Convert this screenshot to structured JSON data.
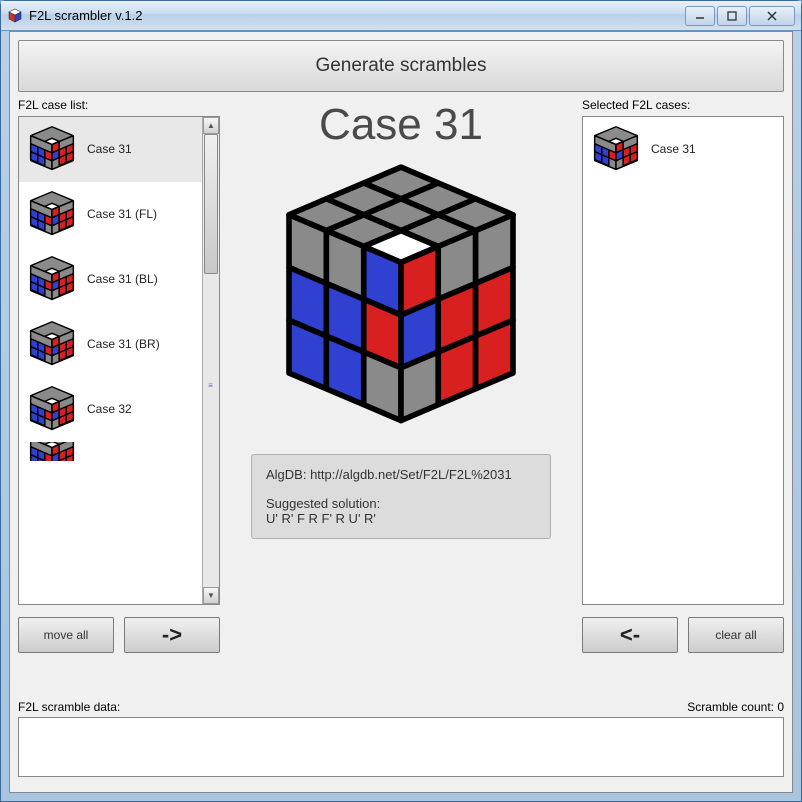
{
  "window": {
    "title": "F2L scrambler v.1.2"
  },
  "toolbar": {
    "generate_label": "Generate scrambles"
  },
  "left": {
    "header": "F2L case list:",
    "items": [
      {
        "label": "Case 31",
        "selected": true
      },
      {
        "label": "Case 31 (FL)",
        "selected": false
      },
      {
        "label": "Case 31 (BL)",
        "selected": false
      },
      {
        "label": "Case 31 (BR)",
        "selected": false
      },
      {
        "label": "Case 32",
        "selected": false
      }
    ],
    "move_all_label": "move all",
    "arrow_label": "->"
  },
  "main": {
    "case_title": "Case 31",
    "algdb_label": "AlgDB: http://algdb.net/Set/F2L/F2L%2031",
    "suggested_heading": "Suggested solution:",
    "suggested_moves": "U' R' F R F' R U' R'"
  },
  "right": {
    "header": "Selected F2L cases:",
    "items": [
      {
        "label": "Case 31"
      }
    ],
    "arrow_label": "<-",
    "clear_all_label": "clear all"
  },
  "scramble": {
    "header": "F2L scramble data:",
    "count_label": "Scramble count: 0"
  }
}
